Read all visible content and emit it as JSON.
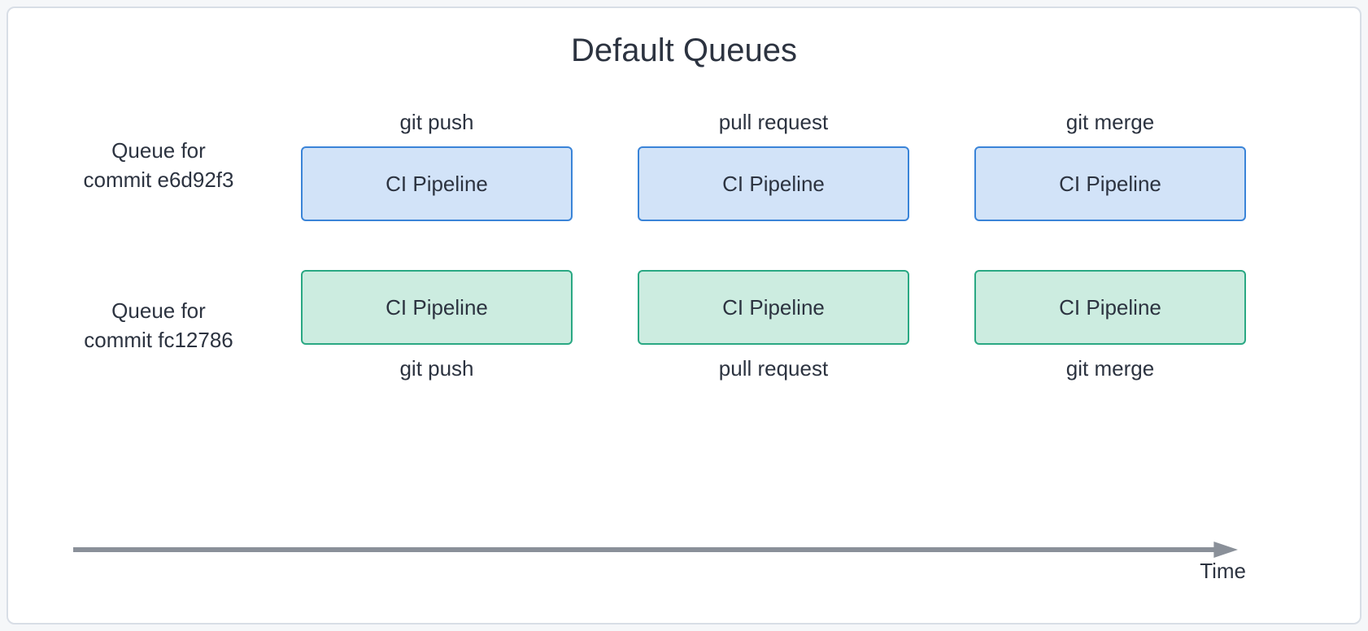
{
  "title": "Default Queues",
  "axis_label": "Time",
  "queues": [
    {
      "label_line1": "Queue for",
      "label_line2": "commit e6d92f3",
      "color": "blue",
      "label_position": "top",
      "stages": [
        {
          "event": "git push",
          "box": "CI Pipeline"
        },
        {
          "event": "pull request",
          "box": "CI Pipeline"
        },
        {
          "event": "git merge",
          "box": "CI Pipeline"
        }
      ]
    },
    {
      "label_line1": "Queue for",
      "label_line2": "commit fc12786",
      "color": "green",
      "label_position": "bottom",
      "stages": [
        {
          "event": "git push",
          "box": "CI Pipeline"
        },
        {
          "event": "pull request",
          "box": "CI Pipeline"
        },
        {
          "event": "git merge",
          "box": "CI Pipeline"
        }
      ]
    }
  ]
}
